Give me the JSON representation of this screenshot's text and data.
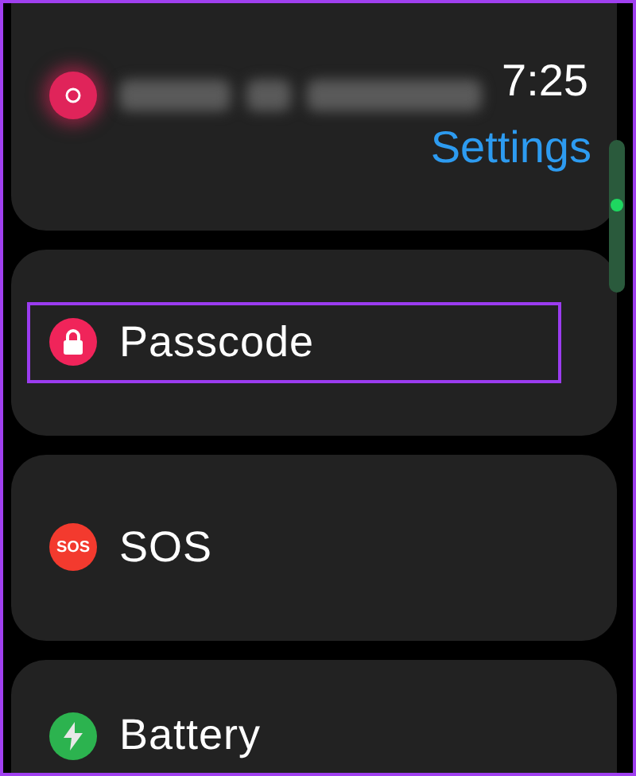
{
  "status": {
    "time": "7:25",
    "title": "Settings"
  },
  "items": [
    {
      "kind": "blurred",
      "color": "#e0245a",
      "highlighted": false
    },
    {
      "kind": "lock",
      "label": "Passcode",
      "color": "#f0245a",
      "highlighted": true
    },
    {
      "kind": "sos",
      "label": "SOS",
      "badge": "SOS",
      "color": "#f33a2e",
      "highlighted": false
    },
    {
      "kind": "bolt",
      "label": "Battery",
      "color": "#2cb34f",
      "highlighted": false
    }
  ]
}
